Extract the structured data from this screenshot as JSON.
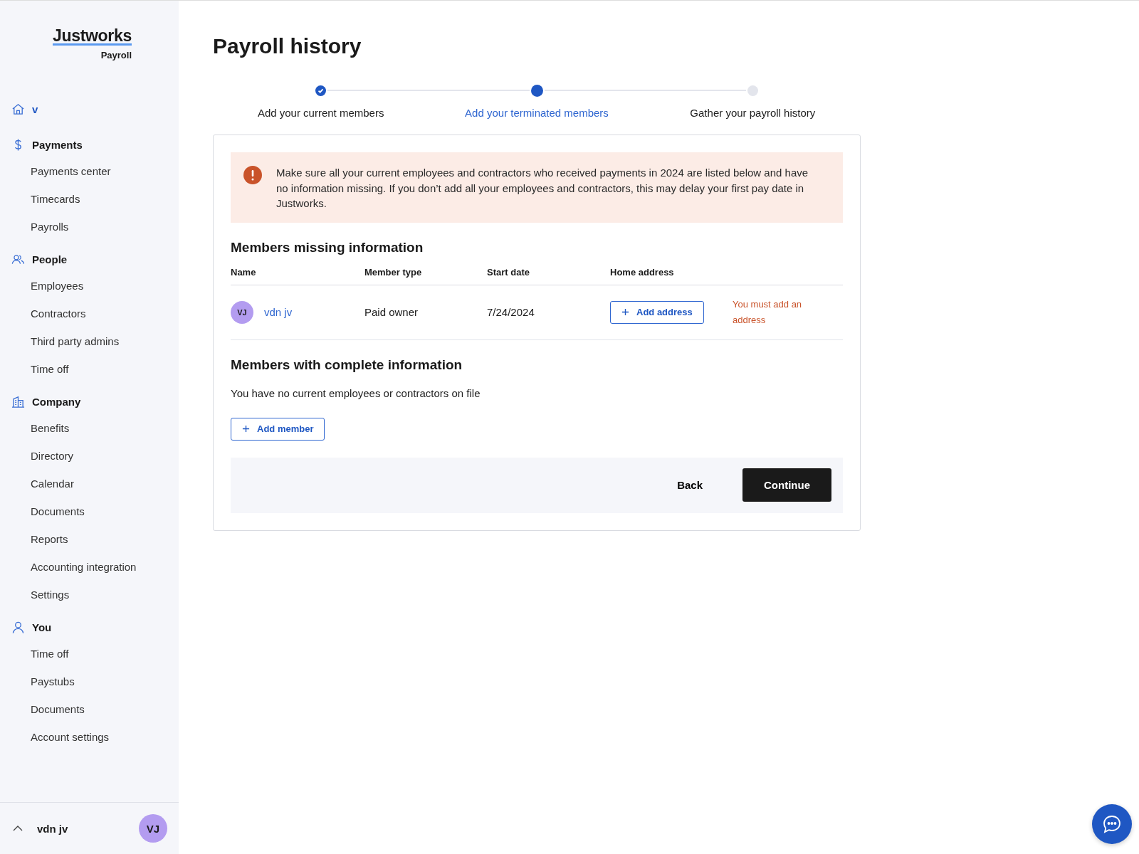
{
  "logo": {
    "name": "Justworks",
    "product": "Payroll"
  },
  "sidebar": {
    "sections": [
      {
        "kind": "home",
        "title": "v"
      },
      {
        "kind": "payments",
        "title": "Payments",
        "items": [
          "Payments center",
          "Timecards",
          "Payrolls"
        ]
      },
      {
        "kind": "people",
        "title": "People",
        "items": [
          "Employees",
          "Contractors",
          "Third party admins",
          "Time off"
        ]
      },
      {
        "kind": "company",
        "title": "Company",
        "items": [
          "Benefits",
          "Directory",
          "Calendar",
          "Documents",
          "Reports",
          "Accounting integration",
          "Settings"
        ]
      },
      {
        "kind": "you",
        "title": "You",
        "items": [
          "Time off",
          "Paystubs",
          "Documents",
          "Account settings"
        ]
      }
    ],
    "user": {
      "name": "vdn jv",
      "initials": "VJ"
    }
  },
  "page": {
    "title": "Payroll history"
  },
  "steps": [
    {
      "label": "Add your current members",
      "complete": true,
      "selected": false
    },
    {
      "label": "Add your terminated members",
      "complete": false,
      "selected": true
    },
    {
      "label": "Gather your payroll history",
      "complete": false,
      "selected": false
    }
  ],
  "alert": {
    "text": "Make sure all your current employees and contractors who received payments in 2024 are listed below and have no information missing. If you don’t add all your employees and contractors, this may delay your first pay date in Justworks."
  },
  "missing": {
    "title": "Members missing information",
    "columns": [
      "Name",
      "Member type",
      "Start date",
      "Home address"
    ],
    "rows": [
      {
        "initials": "VJ",
        "name": "vdn jv",
        "member_type": "Paid owner",
        "start_date": "7/24/2024",
        "action": "Add address",
        "error": "You must add an address"
      }
    ]
  },
  "complete": {
    "title": "Members with complete information",
    "empty": "You have no current employees or contractors on file",
    "add_button": "Add member"
  },
  "footer": {
    "back": "Back",
    "continue": "Continue"
  }
}
